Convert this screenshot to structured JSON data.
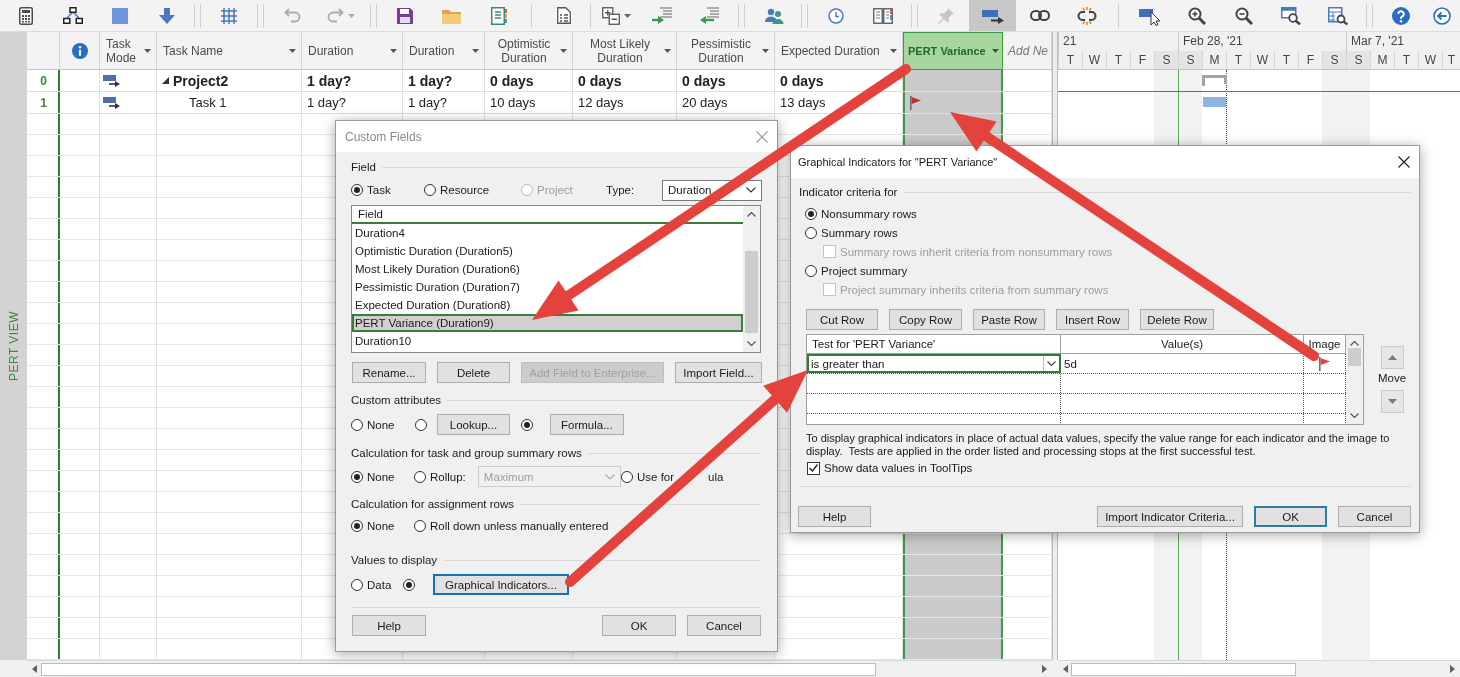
{
  "toolbar": [
    {
      "buttons": [
        {
          "selected": false,
          "disabled": false
        },
        {
          "selected": false,
          "disabled": false
        },
        {
          "selected": false,
          "disabled": false
        },
        {
          "selected": false,
          "disabled": false
        }
      ]
    },
    {
      "buttons": [
        {
          "selected": false,
          "disabled": false
        }
      ]
    },
    {
      "buttons": [
        {
          "selected": false,
          "disabled": true
        },
        {
          "selected": false,
          "disabled": true
        }
      ]
    },
    {
      "buttons": [
        {
          "selected": false,
          "disabled": false
        },
        {
          "selected": false,
          "disabled": false
        },
        {
          "selected": false,
          "disabled": false
        }
      ]
    },
    {
      "buttons": [
        {
          "selected": false,
          "disabled": false
        }
      ]
    },
    {
      "buttons": [
        {
          "selected": false,
          "disabled": false
        },
        {
          "selected": false,
          "disabled": false
        },
        {
          "selected": false,
          "disabled": false
        }
      ]
    },
    {
      "buttons": [
        {
          "selected": false,
          "disabled": false
        }
      ]
    },
    {
      "buttons": [
        {
          "selected": false,
          "disabled": false
        },
        {
          "selected": false,
          "disabled": false
        }
      ]
    },
    {
      "buttons": [
        {
          "selected": false,
          "disabled": true
        },
        {
          "selected": true,
          "disabled": false
        },
        {
          "selected": false,
          "disabled": false
        },
        {
          "selected": false,
          "disabled": false
        }
      ]
    },
    {
      "buttons": [
        {
          "selected": false,
          "disabled": false
        },
        {
          "selected": false,
          "disabled": false
        },
        {
          "selected": false,
          "disabled": false
        },
        {
          "selected": false,
          "disabled": false
        },
        {
          "selected": false,
          "disabled": false
        }
      ]
    },
    {
      "buttons": [
        {
          "selected": false,
          "disabled": false
        },
        {
          "selected": false,
          "disabled": false
        }
      ]
    }
  ],
  "view_label": "PERT VIEW",
  "table": {
    "columns": [
      {
        "kind": "id",
        "selected": false
      },
      {
        "kind": "indicators",
        "selected": false
      },
      {
        "kind": "mode",
        "label": "Task Mode",
        "selected": false
      },
      {
        "kind": "name",
        "label": "Task Name",
        "selected": false
      },
      {
        "kind": "value",
        "label": "Duration",
        "selected": false
      },
      {
        "kind": "value",
        "label": "Duration",
        "selected": false
      },
      {
        "kind": "value",
        "label": "Optimistic Duration",
        "selected": false
      },
      {
        "kind": "value",
        "label": "Most Likely Duration",
        "selected": false
      },
      {
        "kind": "value",
        "label": "Pessimistic Duration",
        "selected": false
      },
      {
        "kind": "value",
        "label": "Expected Duration",
        "selected": false
      },
      {
        "kind": "graphic",
        "label": "PERT Variance",
        "selected": true
      },
      {
        "kind": "add",
        "label": "Add Ne",
        "selected": false
      }
    ],
    "rows": [
      {
        "id": "0",
        "name": "Project2",
        "expanded": true,
        "values": [
          "1 day?",
          "1 day?",
          "0 days",
          "0 days",
          "0 days",
          "0 days"
        ],
        "indicator": false,
        "children": [
          {
            "id": "1",
            "name": "Task 1",
            "values": [
              "1 day?",
              "1 day?",
              "10 days",
              "12 days",
              "20 days",
              "13 days"
            ],
            "indicator": true
          }
        ]
      }
    ]
  },
  "gantt": {
    "weeks": [
      {
        "label": "21",
        "days": [
          {
            "label": "T",
            "nonworking": false
          },
          {
            "label": "W",
            "nonworking": false
          },
          {
            "label": "T",
            "nonworking": false
          },
          {
            "label": "F",
            "nonworking": false
          },
          {
            "label": "S",
            "nonworking": true
          }
        ]
      },
      {
        "label": "Feb 28, '21",
        "days": [
          {
            "label": "S",
            "nonworking": true
          },
          {
            "label": "M",
            "nonworking": false
          },
          {
            "label": "T",
            "nonworking": false
          },
          {
            "label": "W",
            "nonworking": false
          },
          {
            "label": "T",
            "nonworking": false
          },
          {
            "label": "F",
            "nonworking": false
          },
          {
            "label": "S",
            "nonworking": true
          }
        ]
      },
      {
        "label": "Mar 7, '21",
        "days": [
          {
            "label": "S",
            "nonworking": true
          },
          {
            "label": "M",
            "nonworking": false
          },
          {
            "label": "T",
            "nonworking": false
          },
          {
            "label": "W",
            "nonworking": false
          },
          {
            "label": "T",
            "nonworking": false
          }
        ]
      }
    ]
  },
  "custom_fields": {
    "title": "Custom Fields",
    "active": false,
    "field_group": "Field",
    "entities": [
      {
        "label": "Task",
        "selected": true,
        "disabled": false
      },
      {
        "label": "Resource",
        "selected": false,
        "disabled": false
      },
      {
        "label": "Project",
        "selected": false,
        "disabled": true
      }
    ],
    "type_label": "Type:",
    "type_value": "Duration",
    "list_header": "Field",
    "fields": [
      {
        "label": "Duration4",
        "selected": false
      },
      {
        "label": "Optimistic Duration (Duration5)",
        "selected": false
      },
      {
        "label": "Most Likely Duration (Duration6)",
        "selected": false
      },
      {
        "label": "Pessimistic Duration (Duration7)",
        "selected": false
      },
      {
        "label": "Expected Duration (Duration8)",
        "selected": false
      },
      {
        "label": "PERT Variance (Duration9)",
        "selected": true
      },
      {
        "label": "Duration10",
        "selected": false
      }
    ],
    "field_buttons": [
      {
        "label": "Rename...",
        "disabled": false
      },
      {
        "label": "Delete",
        "disabled": false
      },
      {
        "label": "Add Field to Enterprise...",
        "disabled": true
      },
      {
        "label": "Import Field...",
        "disabled": false
      }
    ],
    "sections": [
      {
        "title": "Custom attributes",
        "options": [
          {
            "kind": "label",
            "label": "None",
            "selected": false
          },
          {
            "kind": "button",
            "label": "Lookup...",
            "selected": false,
            "focused": false
          },
          {
            "kind": "button",
            "label": "Formula...",
            "selected": true,
            "focused": false
          }
        ]
      },
      {
        "title": "Calculation for task and group summary rows",
        "options": [
          {
            "kind": "label",
            "label": "None",
            "selected": true
          },
          {
            "kind": "select",
            "label": "Rollup:",
            "selected": false,
            "value": "Maximum",
            "disabled": true
          },
          {
            "kind": "label",
            "label": "Use for",
            "label_tail": "ula",
            "selected": false
          }
        ]
      },
      {
        "title": "Calculation for assignment rows",
        "options": [
          {
            "kind": "label",
            "label": "None",
            "selected": true
          },
          {
            "kind": "label",
            "label": "Roll down unless manually entered",
            "selected": false
          }
        ]
      },
      {
        "title": "Values to display",
        "options": [
          {
            "kind": "label",
            "label": "Data",
            "selected": false
          },
          {
            "kind": "button",
            "label": "Graphical Indicators...",
            "selected": true,
            "focused": true
          }
        ]
      }
    ],
    "buttons": [
      {
        "label": "Help"
      },
      {
        "label": "OK"
      },
      {
        "label": "Cancel"
      }
    ]
  },
  "indicators_dialog": {
    "title": "Graphical Indicators for \"PERT Variance\"",
    "active": true,
    "criteria_label": "Indicator criteria for",
    "criteria": [
      {
        "label": "Nonsummary rows",
        "selected": true
      },
      {
        "label": "Summary rows",
        "selected": false,
        "inherit": {
          "label": "Summary rows inherit criteria from nonsummary rows",
          "checked": false,
          "disabled": true
        }
      },
      {
        "label": "Project summary",
        "selected": false,
        "inherit": {
          "label": "Project summary inherits criteria from summary rows",
          "checked": false,
          "disabled": true
        }
      }
    ],
    "row_buttons": [
      "Cut Row",
      "Copy Row",
      "Paste Row",
      "Insert Row",
      "Delete Row"
    ],
    "grid": {
      "columns": [
        "Test for 'PERT Variance'",
        "Value(s)",
        "Image"
      ],
      "rows": [
        {
          "test": "is greater than",
          "value": "5d"
        }
      ]
    },
    "move_label": "Move",
    "description": "To display graphical indicators in place of actual data values, specify the value range for each indicator and the image to display.  Tests are applied in the order listed and processing stops at the first successful test.",
    "tooltips": {
      "label": "Show data values in ToolTips",
      "checked": true
    },
    "buttons": [
      {
        "label": "Help",
        "default": false
      },
      {
        "label": "Import Indicator Criteria...",
        "default": false
      },
      {
        "label": "OK",
        "default": true
      },
      {
        "label": "Cancel",
        "default": false
      }
    ]
  }
}
